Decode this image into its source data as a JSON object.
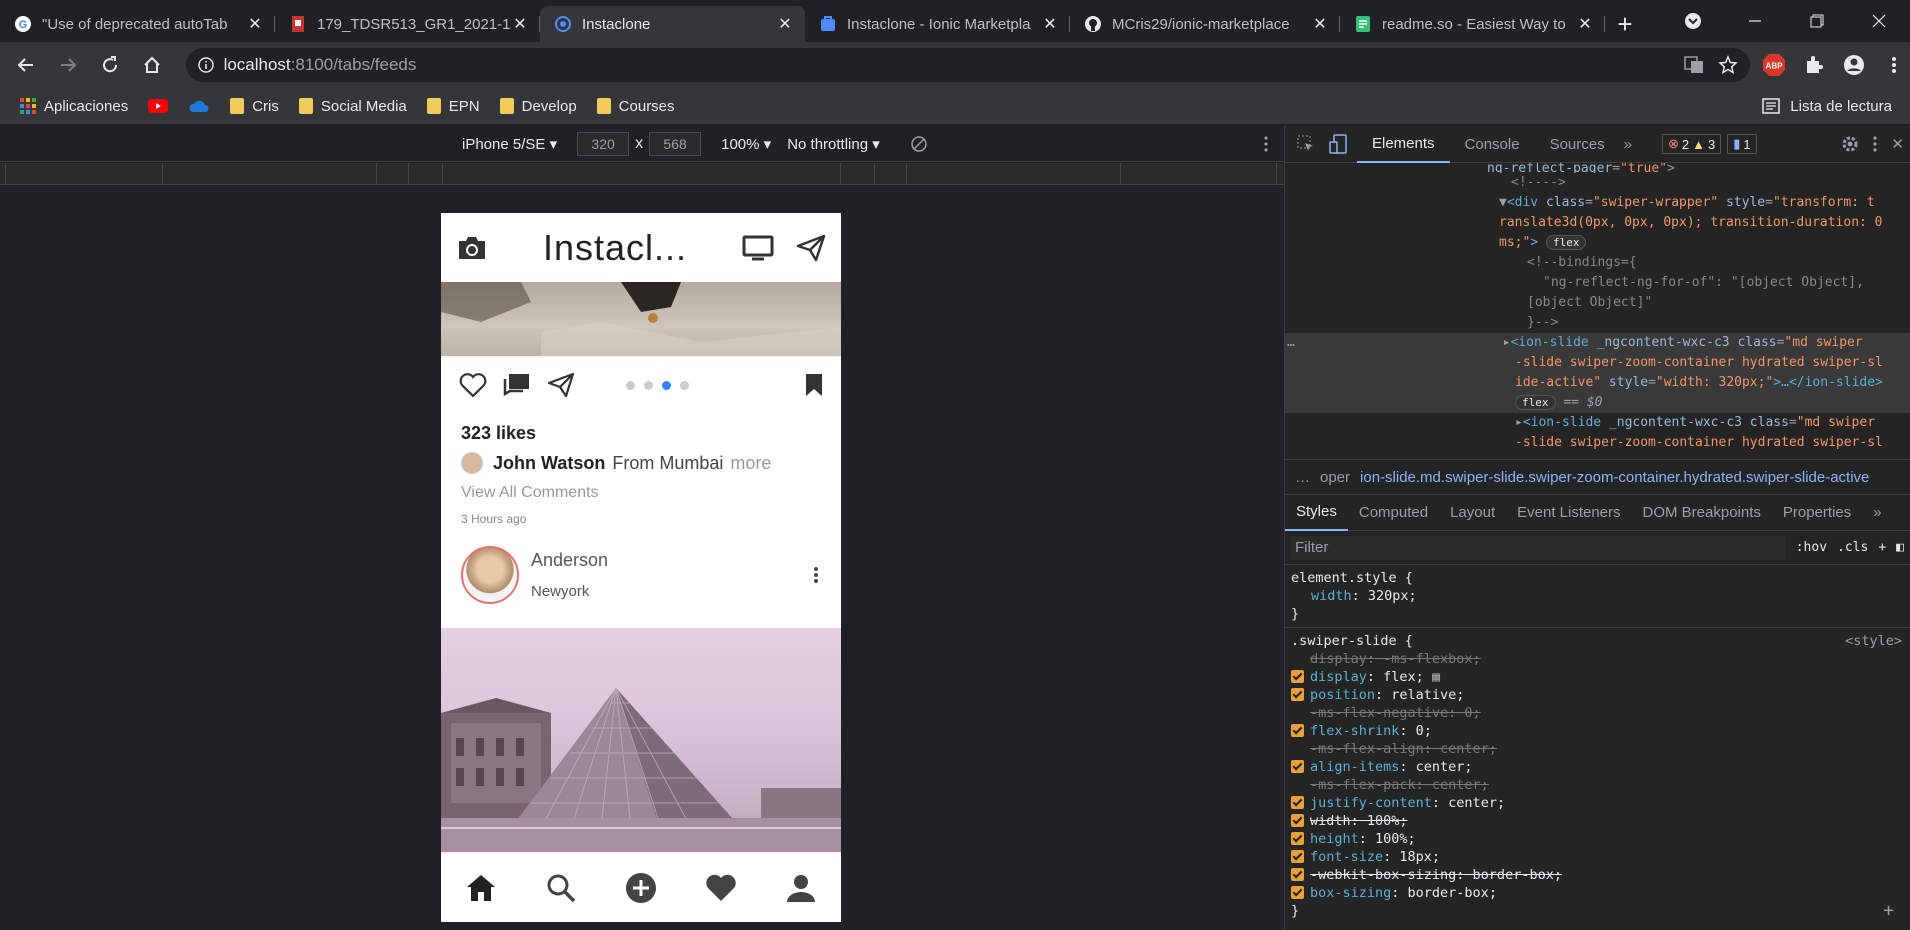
{
  "tabs": [
    {
      "title": "\"Use of deprecated autoTab",
      "icon": "google-icon",
      "active": false
    },
    {
      "title": "179_TDSR513_GR1_2021-1:",
      "icon": "file-icon",
      "active": false
    },
    {
      "title": "Instaclone",
      "icon": "ionic-icon",
      "active": true
    },
    {
      "title": "Instaclone - Ionic Marketpla",
      "icon": "marketplace-icon",
      "active": false
    },
    {
      "title": "MCris29/ionic-marketplace",
      "icon": "github-icon",
      "active": false
    },
    {
      "title": "readme.so - Easiest Way to",
      "icon": "readme-icon",
      "active": false
    }
  ],
  "address": {
    "host": "localhost",
    "path": ":8100/tabs/feeds"
  },
  "bookmarks": [
    {
      "label": "Aplicaciones",
      "icon": "apps-icon"
    },
    {
      "label": "",
      "icon": "youtube-icon"
    },
    {
      "label": "",
      "icon": "onedrive-icon"
    },
    {
      "label": "Cris",
      "icon": "folder-icon"
    },
    {
      "label": "Social Media",
      "icon": "folder-icon"
    },
    {
      "label": "EPN",
      "icon": "folder-icon"
    },
    {
      "label": "Develop",
      "icon": "folder-icon"
    },
    {
      "label": "Courses",
      "icon": "folder-icon"
    }
  ],
  "reading_list": "Lista de lectura",
  "device_toolbar": {
    "device": "iPhone 5/SE",
    "width": "320",
    "height": "568",
    "zoom": "100%",
    "throttling": "No throttling",
    "times": "x"
  },
  "app": {
    "title": "Instacl...",
    "likes": "323 likes",
    "user": "John Watson",
    "location": "From Mumbai",
    "more": "more",
    "view_all": "View All Comments",
    "time": "3 Hours ago",
    "post2_user": "Anderson",
    "post2_location": "Newyork",
    "slide_count": 4,
    "active_slide": 2
  },
  "devtools": {
    "tabs": [
      "Elements",
      "Console",
      "Sources"
    ],
    "errors": "2",
    "warnings": "3",
    "messages": "1",
    "breadcrumb_prev": "oper",
    "breadcrumb": "ion-slide.md.swiper-slide.swiper-zoom-container.hydrated.swiper-slide-active",
    "style_tabs": [
      "Styles",
      "Computed",
      "Layout",
      "Event Listeners",
      "DOM Breakpoints",
      "Properties"
    ],
    "filter_placeholder": "Filter",
    "hov": ":hov",
    "cls": ".cls",
    "element_style": "element.style {",
    "element_width": "320px;",
    "rule_selector": ".swiper-slide {",
    "rule_source": "<style>"
  }
}
